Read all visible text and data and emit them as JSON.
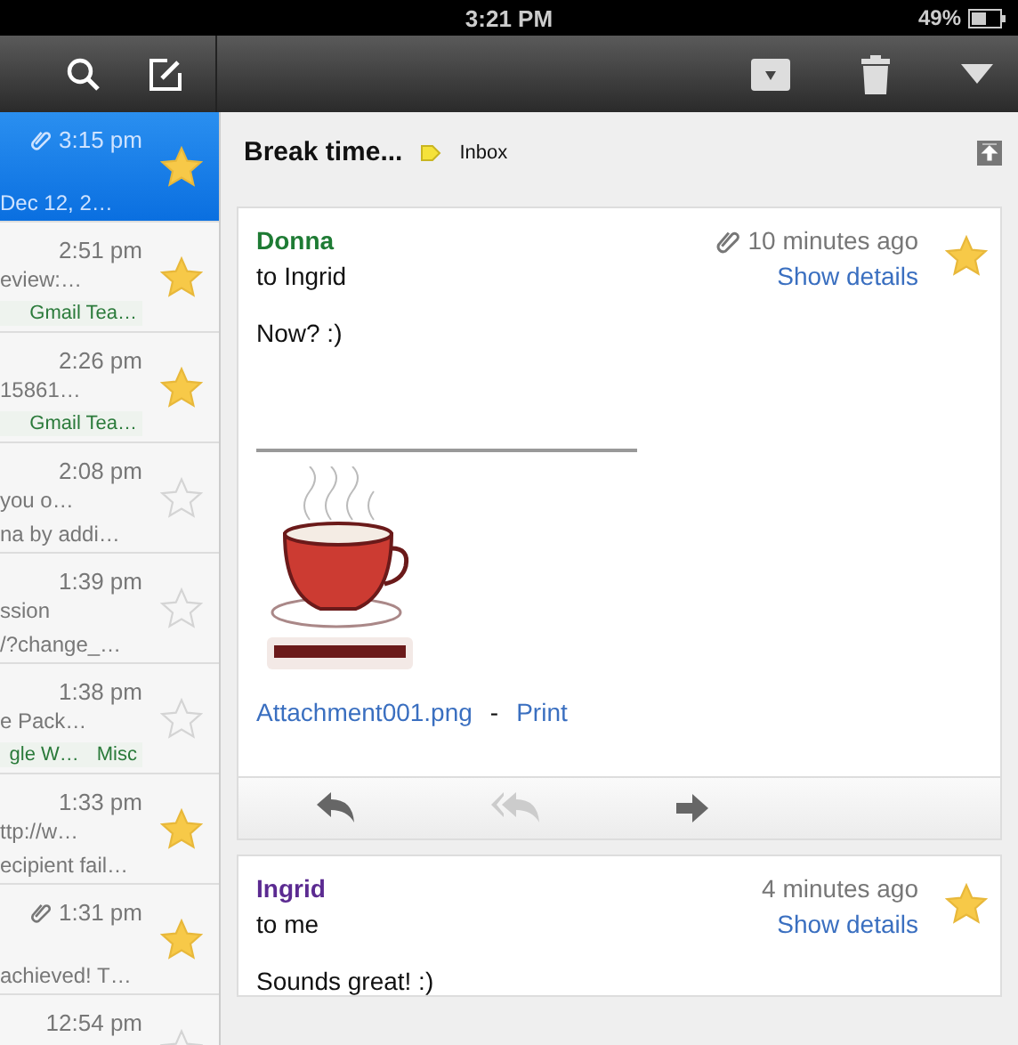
{
  "status_bar": {
    "time": "3:21 PM",
    "battery": "49%"
  },
  "list": [
    {
      "selected": true,
      "attachment": true,
      "time": "3:15 pm",
      "line3": "Dec 12, 2…",
      "starred": true
    },
    {
      "selected": false,
      "attachment": false,
      "time": "2:51 pm",
      "line2": "eview:…",
      "labels": [
        "Gmail Tea…"
      ],
      "starred": true
    },
    {
      "selected": false,
      "attachment": false,
      "time": "2:26 pm",
      "line2": "15861…",
      "labels": [
        "Gmail Tea…"
      ],
      "starred": true
    },
    {
      "selected": false,
      "attachment": false,
      "time": "2:08 pm",
      "line2": "you o…",
      "line3": "na by addi…",
      "starred": false
    },
    {
      "selected": false,
      "attachment": false,
      "time": "1:39 pm",
      "line2": "ssion",
      "line3": "/?change_…",
      "starred": false
    },
    {
      "selected": false,
      "attachment": false,
      "time": "1:38 pm",
      "line2": "e Pack…",
      "labels": [
        "gle W…",
        "Misc"
      ],
      "starred": false
    },
    {
      "selected": false,
      "attachment": false,
      "time": "1:33 pm",
      "line2": "ttp://w…",
      "line3": "ecipient fail…",
      "starred": true
    },
    {
      "selected": false,
      "attachment": true,
      "time": "1:31 pm",
      "line3": "achieved! T…",
      "starred": true
    },
    {
      "selected": false,
      "attachment": false,
      "time": "12:54 pm",
      "starred": false
    }
  ],
  "conversation": {
    "subject": "Break time...",
    "label": "Inbox",
    "messages": [
      {
        "sender": "Donna",
        "color": "#1e7b34",
        "to": "to Ingrid",
        "attachment": true,
        "when": "10 minutes ago",
        "details": "Show details",
        "starred": true,
        "body": "Now? :)",
        "file": "Attachment001.png",
        "separator": "-",
        "print": "Print",
        "actions": [
          {
            "kind": "reply",
            "disabled": false
          },
          {
            "kind": "reply_all",
            "disabled": true
          },
          {
            "kind": "forward",
            "disabled": false
          }
        ]
      },
      {
        "sender": "Ingrid",
        "color": "#5b2a91",
        "to": "to me",
        "attachment": false,
        "when": "4 minutes ago",
        "details": "Show details",
        "starred": true,
        "body": "Sounds great! :)"
      }
    ]
  }
}
